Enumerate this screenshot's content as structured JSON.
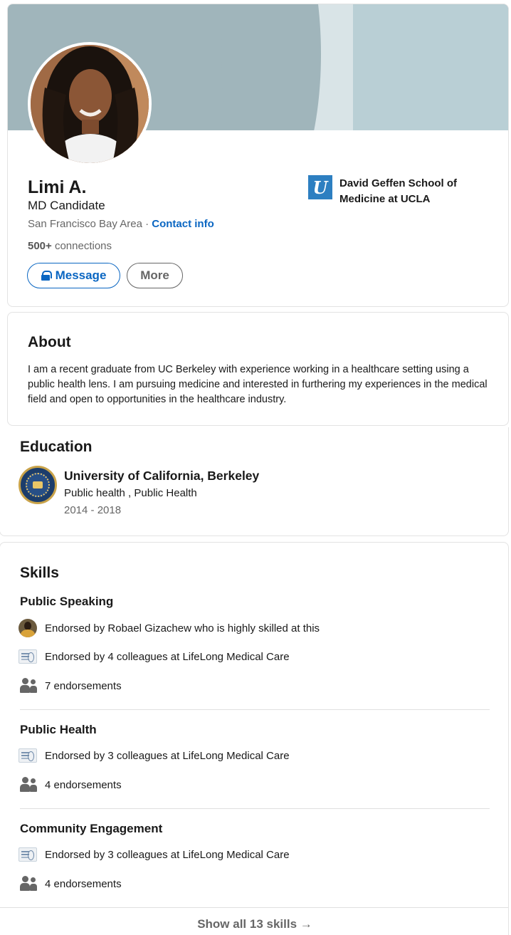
{
  "profile": {
    "name": "Limi A.",
    "headline": "MD Candidate",
    "location": "San Francisco Bay Area",
    "separator": " · ",
    "contact_info": "Contact info",
    "connections_count": "500+",
    "connections_label": " connections",
    "buttons": {
      "message": "Message",
      "more": "More"
    },
    "school": {
      "logo_letter": "U",
      "name": "David Geffen School of Medicine at UCLA"
    }
  },
  "about": {
    "title": "About",
    "text": "I am a recent graduate from UC Berkeley with experience working in a healthcare setting using a public health lens. I am pursuing medicine and interested in furthering my experiences in the medical field and open to opportunities in the healthcare industry."
  },
  "education": {
    "title": "Education",
    "school": "University of California, Berkeley",
    "field": "Public health , Public Health",
    "years": "2014 - 2018"
  },
  "skills": {
    "title": "Skills",
    "items": [
      {
        "name": "Public Speaking",
        "endorsed_by_person": "Endorsed by Robael Gizachew who is highly skilled at this",
        "endorsed_by_colleagues": "Endorsed by 4 colleagues at LifeLong Medical Care",
        "endorsements": "7 endorsements"
      },
      {
        "name": "Public Health",
        "endorsed_by_colleagues": "Endorsed by 3 colleagues at LifeLong Medical Care",
        "endorsements": "4 endorsements"
      },
      {
        "name": "Community Engagement",
        "endorsed_by_colleagues": "Endorsed by 3 colleagues at LifeLong Medical Care",
        "endorsements": "4 endorsements"
      }
    ],
    "show_all": "Show all 13 skills →"
  }
}
